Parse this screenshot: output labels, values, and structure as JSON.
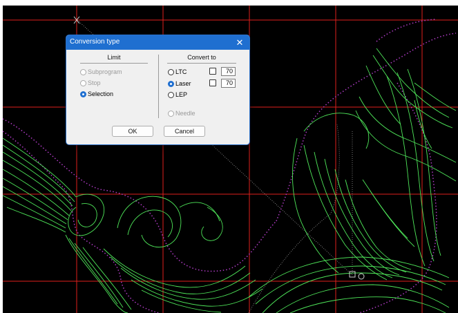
{
  "dialog": {
    "title": "Conversion type",
    "close_glyph": "✕",
    "limit": {
      "heading": "Limit",
      "options": [
        {
          "label": "Subprogram",
          "enabled": false,
          "checked": false
        },
        {
          "label": "Stop",
          "enabled": false,
          "checked": false
        },
        {
          "label": "Selection",
          "enabled": true,
          "checked": true
        }
      ]
    },
    "convert_to": {
      "heading": "Convert to",
      "options": [
        {
          "label": "LTC",
          "checked": false,
          "checkbox": false,
          "value": "70"
        },
        {
          "label": "Laser",
          "checked": true,
          "checkbox": false,
          "value": "70"
        },
        {
          "label": "LEP",
          "checked": false
        },
        {
          "label": "Needle",
          "checked": false,
          "enabled": false
        }
      ]
    },
    "ok_label": "OK",
    "cancel_label": "Cancel"
  },
  "canvas": {
    "background": "#000000",
    "grid_color": "#e0201c",
    "stroke_color": "#4fe85a",
    "outline_color": "#b23cc8"
  }
}
